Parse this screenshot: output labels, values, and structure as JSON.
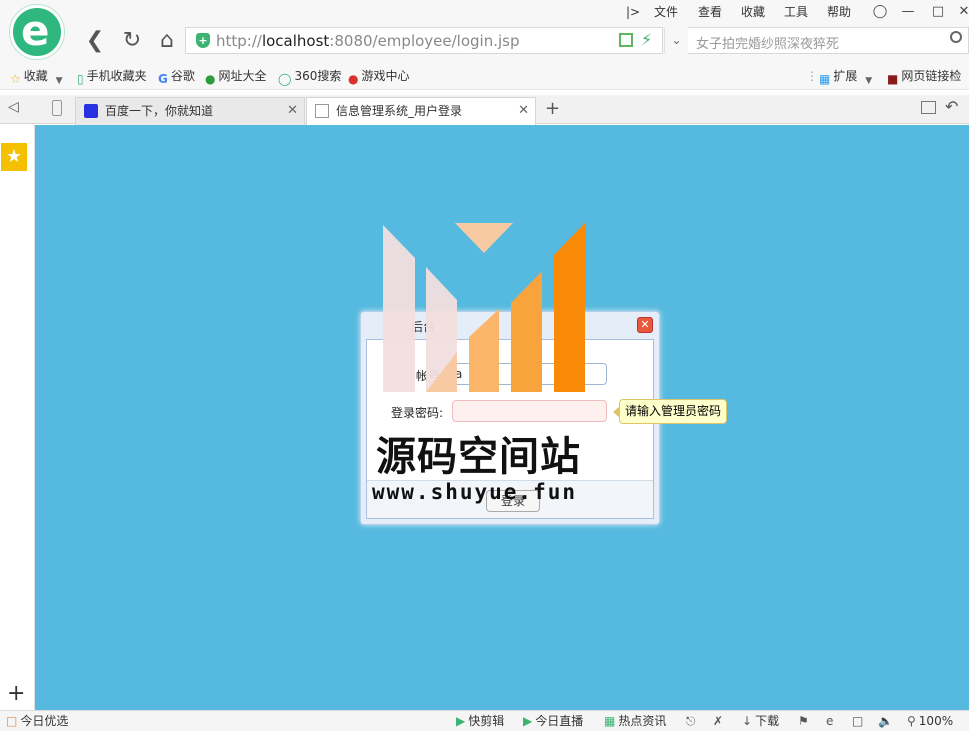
{
  "browser": {
    "menu": [
      "文件",
      "查看",
      "收藏",
      "工具",
      "帮助"
    ],
    "address": {
      "scheme": "http://",
      "host": "localhost",
      "rest": ":8080/employee/login.jsp"
    },
    "search_placeholder": "女子拍完婚纱照深夜猝死"
  },
  "bookmarks": {
    "items": [
      "收藏",
      "手机收藏夹",
      "谷歌",
      "网址大全",
      "360搜索",
      "游戏中心"
    ],
    "right": [
      "扩展",
      "网页链接检"
    ]
  },
  "tabs": [
    {
      "label": "百度一下，你就知道",
      "active": false
    },
    {
      "label": "信息管理系统_用户登录",
      "active": true
    }
  ],
  "login": {
    "title": "后台",
    "account_label": "帐号",
    "account_value": "a",
    "password_label": "登录密码:",
    "password_tip": "请输入管理员密码",
    "submit_label": "登录"
  },
  "watermark": {
    "cn": "源码空间站",
    "en": "www.shuyue.fun"
  },
  "statusbar": {
    "left": "今日优选",
    "items": [
      "快剪辑",
      "今日直播",
      "热点资讯",
      "下载"
    ],
    "zoom": "100%"
  },
  "colors": {
    "page_bg": "#56b9df",
    "brand": "#2eb87f",
    "watermark_orange": "#f98a08"
  }
}
